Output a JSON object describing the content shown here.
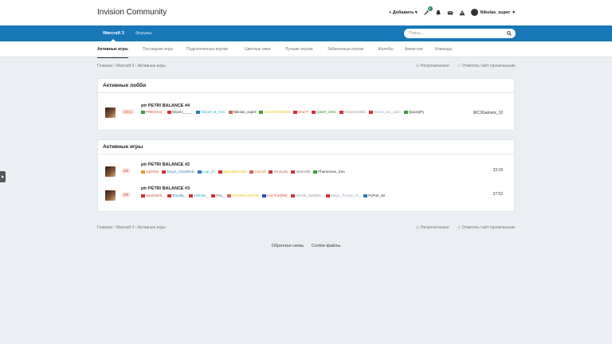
{
  "header": {
    "logo": "Invision Community",
    "add_label": "Добавить",
    "notif_count": "1",
    "username": "Nikolas_super"
  },
  "nav": {
    "tabs": [
      {
        "label": "Warcraft 3"
      },
      {
        "label": "Форумы"
      }
    ],
    "search_placeholder": "Поиск..."
  },
  "subnav": {
    "tabs": [
      {
        "label": "Активные игры"
      },
      {
        "label": "Последние игры"
      },
      {
        "label": "Подключенные игроки"
      },
      {
        "label": "Цветные ники"
      },
      {
        "label": "Лучшие игроки"
      },
      {
        "label": "Забаненные игроки"
      },
      {
        "label": "Жалобы"
      },
      {
        "label": "Амнистии"
      },
      {
        "label": "Команды"
      }
    ]
  },
  "breadcrumb": {
    "items": [
      "Главная",
      "Warcraft 3",
      "Активные игры"
    ],
    "unread": "Непрочитанное",
    "mark_read": "Отметить сайт прочитанным"
  },
  "lobbies": {
    "title": "Активные лобби",
    "rows": [
      {
        "slots": "10/11",
        "name": "ptr PETRI BALANCE #4",
        "right": "WC3Gamers_10",
        "players": [
          {
            "name": "FRESH23_",
            "color": "#d9534f",
            "flag": "#3a9d3a"
          },
          {
            "name": "iMpakt_____",
            "color": "#555",
            "flag": "#c33"
          },
          {
            "name": "TalkoM_B_HoC",
            "color": "#2bb5b5",
            "flag": "#2a7ab8"
          },
          {
            "name": "Nikolas_super",
            "color": "#333",
            "flag": "#c65"
          },
          {
            "name": "ZOLOTO3ESSS",
            "color": "#e6c200",
            "flag": "#3a9d3a"
          },
          {
            "name": "Kha77",
            "color": "#e74c3c",
            "flag": "#c33"
          },
          {
            "name": "Qwert_1001",
            "color": "#2e8b2e",
            "flag": "#c33"
          },
          {
            "name": "KnowsSO591",
            "color": "#999",
            "flag": "#c33"
          },
          {
            "name": "Game_pro_pidrs",
            "color": "#9ab",
            "flag": "#c33"
          },
          {
            "name": "QazaQPy",
            "color": "#333",
            "flag": "#3a9d3a"
          }
        ]
      }
    ]
  },
  "games": {
    "title": "Активные игры",
    "rows": [
      {
        "slots": "8/8",
        "name": "ptr PETRI BALANCE #2",
        "right": "33:18",
        "players": [
          {
            "name": "egl2026",
            "color": "#d9534f",
            "flag": "#e0a020"
          },
          {
            "name": "ToLyA_CaXaRoK",
            "color": "#2a7ab8",
            "flag": "#c33"
          },
          {
            "name": "Legi_07",
            "color": "#2bb5b5",
            "flag": "#2a7ab8"
          },
          {
            "name": "lightsaber1983",
            "color": "#e6c200",
            "flag": "#c33"
          },
          {
            "name": "Daxndl",
            "color": "#e08a20",
            "flag": "#c65"
          },
          {
            "name": "himeyalo",
            "color": "#b66",
            "flag": "#c33"
          },
          {
            "name": "darkcelik",
            "color": "#777",
            "flag": "#c33"
          },
          {
            "name": "Phantomas_SSs",
            "color": "#333",
            "flag": "#3a9d3a"
          }
        ]
      },
      {
        "slots": "9/9",
        "name": "ptr PETRI BALANCE #3",
        "right": "27:53",
        "players": [
          {
            "name": "Starkk809_",
            "color": "#d9534f",
            "flag": "#c33"
          },
          {
            "name": "Timolla_",
            "color": "#2a7ab8",
            "flag": "#c33"
          },
          {
            "name": "Shkhike_",
            "color": "#2bb5b5",
            "flag": "#c33"
          },
          {
            "name": "Fris_",
            "color": "#555",
            "flag": "#c33"
          },
          {
            "name": "KOHRHA3ATOR",
            "color": "#e6c200",
            "flag": "#c65"
          },
          {
            "name": "KoCTuK[RB]",
            "color": "#e74c3c",
            "flag": "#2a4aa8"
          },
          {
            "name": "Uzbekl_Nalshils_",
            "color": "#999",
            "flag": "#c33"
          },
          {
            "name": "Mega_Tron15_tS_",
            "color": "#9ab",
            "flag": "#c33"
          },
          {
            "name": "PyPok_xD",
            "color": "#333",
            "flag": "#2a7ab8"
          }
        ]
      }
    ]
  },
  "footer": {
    "breadcrumb": [
      "Главная",
      "Warcraft 3",
      "Активные игры"
    ],
    "unread": "Непрочитанное",
    "mark_read": "Отметить сайт прочитанным",
    "links": [
      "Обратная связь",
      "Cookie-файлы"
    ]
  }
}
